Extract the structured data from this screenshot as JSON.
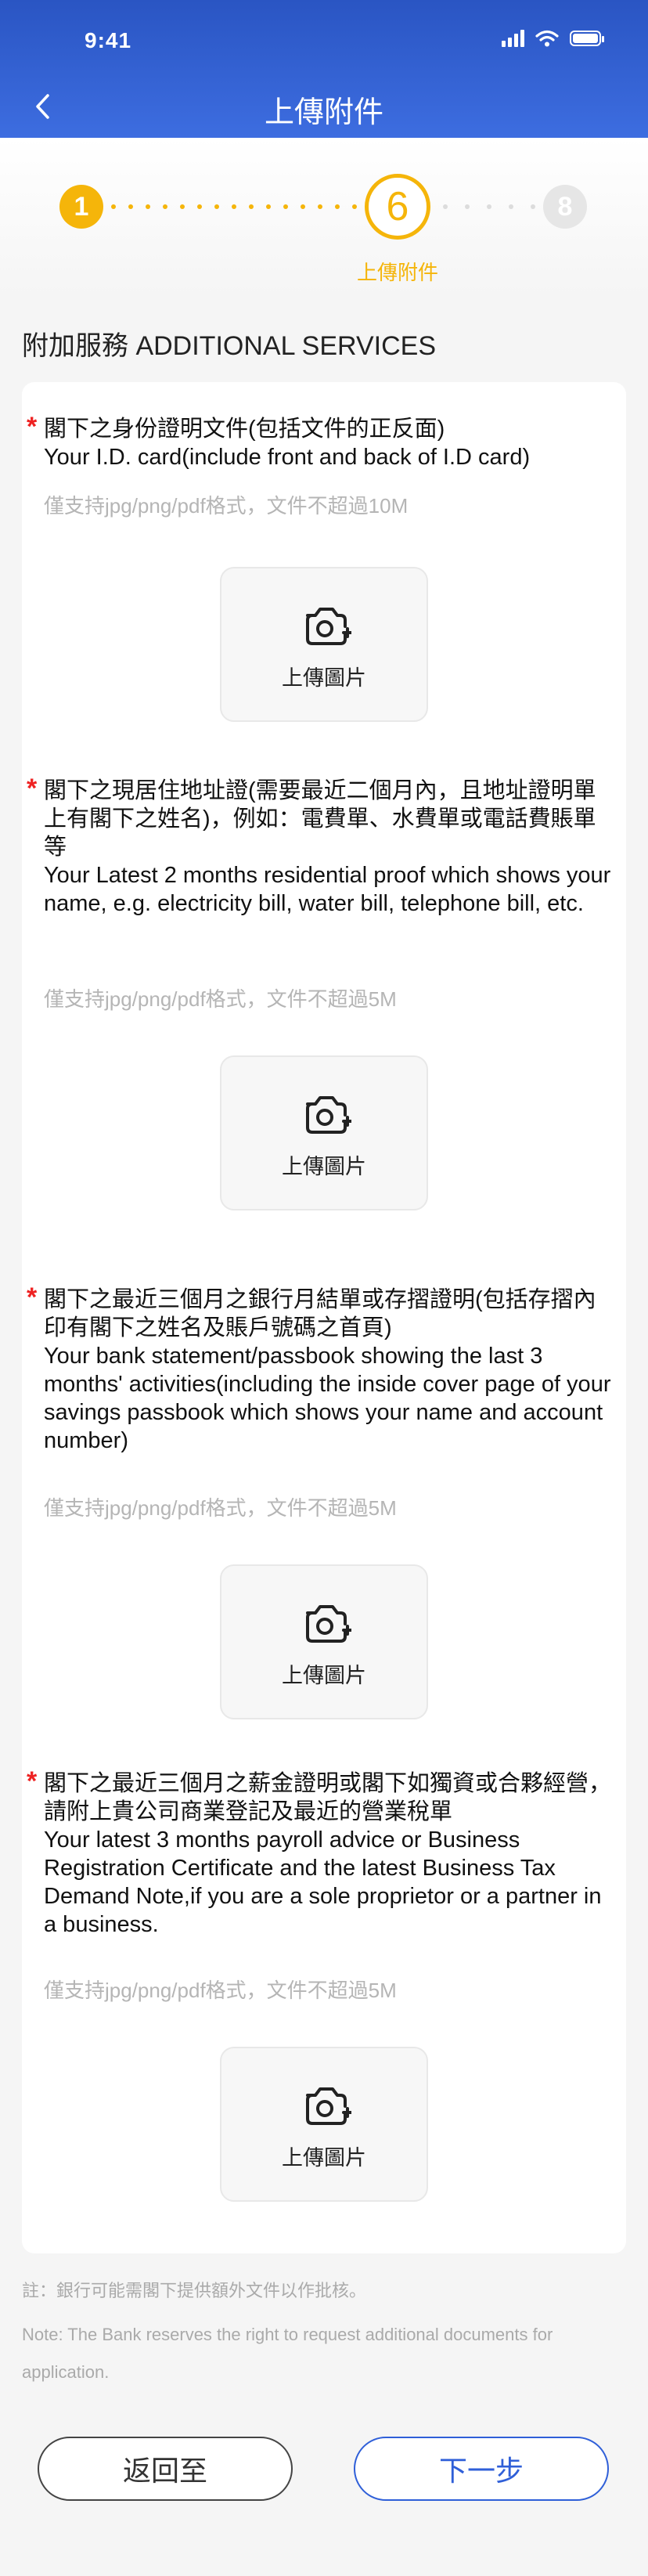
{
  "status_bar": {
    "time": "9:41"
  },
  "nav": {
    "title": "上傳附件"
  },
  "progress": {
    "current_step": "6",
    "first_step": "1",
    "last_step": "8",
    "current_label": "上傳附件",
    "active_color": "#f5b50a"
  },
  "section": {
    "title": "附加服務 ADDITIONAL SERVICES"
  },
  "documents": [
    {
      "zh": "閣下之身份證明文件(包括文件的正反面)",
      "en": "Your I.D. card(include front and back of I.D card)",
      "hint": "僅支持jpg/png/pdf格式，文件不超過10M",
      "upload_label": "上傳圖片"
    },
    {
      "zh": "閣下之現居住地址證(需要最近二個月內，且地址證明單上有閣下之姓名)，例如：電費單、水費單或電話費賬單等",
      "en": "Your Latest 2 months residential proof which shows your name, e.g. electricity bill, water bill, telephone bill, etc.",
      "hint": "僅支持jpg/png/pdf格式，文件不超過5M",
      "upload_label": "上傳圖片"
    },
    {
      "zh": "閣下之最近三個月之銀行月結單或存摺證明(包括存摺內印有閣下之姓名及賬戶號碼之首頁)",
      "en": "Your bank statement/passbook showing the last 3 months' activities(including the inside cover page of your savings passbook which shows your name and account number)",
      "hint": "僅支持jpg/png/pdf格式，文件不超過5M",
      "upload_label": "上傳圖片"
    },
    {
      "zh": "閣下之最近三個月之薪金證明或閣下如獨資或合夥經營，請附上貴公司商業登記及最近的營業稅單",
      "en": "Your latest 3 months payroll advice or Business Registration Certificate and the latest Business Tax Demand Note,if you are a sole proprietor or a partner in a business.",
      "hint": "僅支持jpg/png/pdf格式，文件不超過5M",
      "upload_label": "上傳圖片"
    }
  ],
  "notes": {
    "zh": "註：銀行可能需閣下提供額外文件以作批核。",
    "en": "Note: The Bank reserves the right to request additional documents for application."
  },
  "buttons": {
    "back": "返回至",
    "next": "下一步"
  },
  "colors": {
    "header": "#2a55c3",
    "accent": "#f5b50a",
    "primary": "#2f5fd8",
    "required": "#ee2222"
  }
}
